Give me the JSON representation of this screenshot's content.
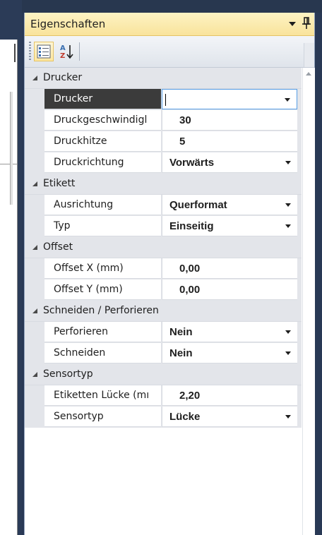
{
  "panel": {
    "title": "Eigenschaften",
    "toolbar": {
      "categorized_icon": "categorized-view-icon",
      "alphabetical_icon": "sort-az-icon"
    }
  },
  "categories": [
    {
      "label": "Drucker",
      "properties": [
        {
          "name": "Drucker",
          "value": "",
          "dropdown": true,
          "selected": true,
          "editing": true
        },
        {
          "name": "Druckgeschwindigkeit",
          "display_name": "Druckgeschwindigl",
          "value": "30",
          "dropdown": false
        },
        {
          "name": "Druckhitze",
          "value": "5",
          "dropdown": false
        },
        {
          "name": "Druckrichtung",
          "value": "Vorwärts",
          "dropdown": true
        }
      ]
    },
    {
      "label": "Etikett",
      "properties": [
        {
          "name": "Ausrichtung",
          "value": "Querformat",
          "dropdown": true
        },
        {
          "name": "Typ",
          "value": "Einseitig",
          "dropdown": true
        }
      ]
    },
    {
      "label": "Offset",
      "properties": [
        {
          "name": "Offset X (mm)",
          "value": "0,00",
          "dropdown": false
        },
        {
          "name": "Offset Y (mm)",
          "value": "0,00",
          "dropdown": false
        }
      ]
    },
    {
      "label": "Schneiden / Perforieren",
      "properties": [
        {
          "name": "Perforieren",
          "value": "Nein",
          "dropdown": true
        },
        {
          "name": "Schneiden",
          "value": "Nein",
          "dropdown": true
        }
      ]
    },
    {
      "label": "Sensortyp",
      "properties": [
        {
          "name": "Etiketten Lücke (mm)",
          "display_name": "Etiketten Lücke (mı",
          "value": "2,20",
          "dropdown": false
        },
        {
          "name": "Sensortyp",
          "value": "Lücke",
          "dropdown": true
        }
      ]
    }
  ],
  "colors": {
    "title_bar": "#f9e39b",
    "selected_row": "#3b3b3b",
    "category_bg": "#e3e5ea",
    "frame": "#293955"
  }
}
